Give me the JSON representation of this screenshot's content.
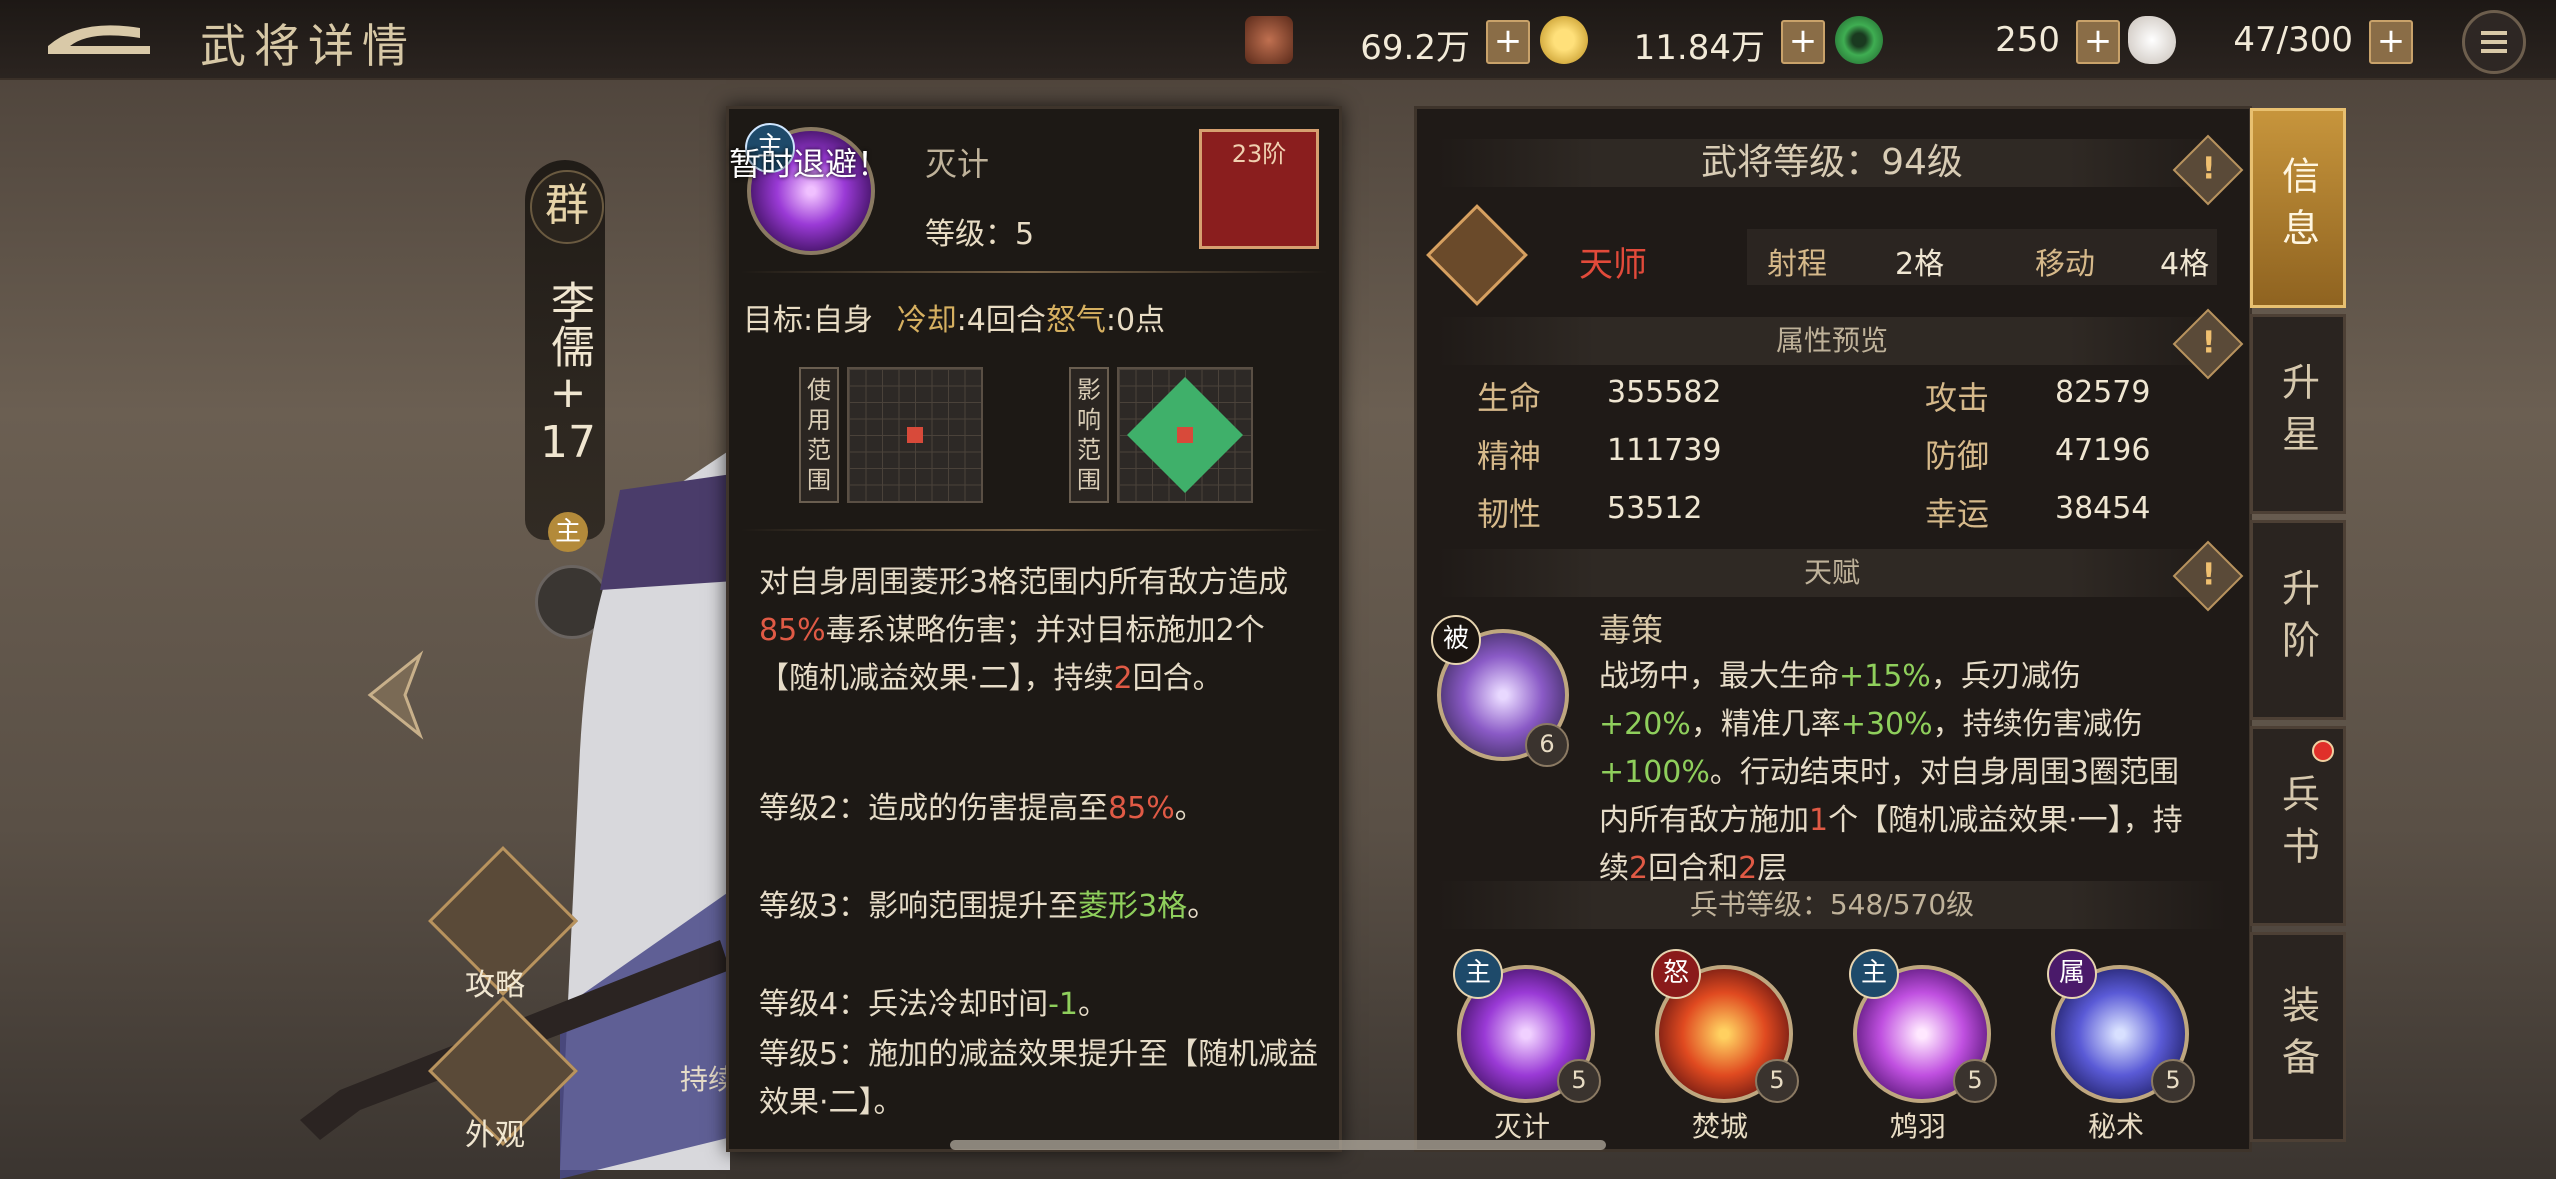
{
  "header": {
    "title": "武将详情"
  },
  "resources": [
    {
      "icon": "copper-coins-icon",
      "value": "69.2万"
    },
    {
      "icon": "gold-coin-icon",
      "value": "11.84万"
    },
    {
      "icon": "jade-icon",
      "value": "250"
    },
    {
      "icon": "stamina-icon",
      "value": "47/300"
    }
  ],
  "hero": {
    "faction": "群",
    "name": "李儒",
    "plus": "+",
    "level_plus": "17",
    "main_badge": "主"
  },
  "left_buttons": {
    "strategy": "攻略",
    "appearance": "外观",
    "partial_text": "持续"
  },
  "skill_popup": {
    "badge": "主",
    "notice": "暂时退避！",
    "name": "灭计",
    "level_text": "等级：5",
    "tier_text": "23阶",
    "target_line": {
      "target_label": "目标",
      "target_value": "自身",
      "cooldown_label": "冷却",
      "cooldown_value": "4回合",
      "rage_label": "怒气",
      "rage_value": "0点"
    },
    "use_range_label": "使用范围",
    "affect_range_label": "影响范围",
    "description": {
      "p1_a": "对自身周围菱形3格范围内所有敌方造成",
      "p1_pct": "85%",
      "p1_b": "毒系谋略伤害；并对目标施加2个【随机减益效果·二】，持续",
      "p1_turns": "2",
      "p1_c": "回合。"
    },
    "levels": [
      {
        "label": "等级2：造成的伤害提高至",
        "hl": "85%",
        "tail": "。"
      },
      {
        "label": "等级3：影响范围提升至",
        "hl": "菱形3格",
        "tail": "。"
      },
      {
        "label": "等级4：兵法冷却时间",
        "hl": "-1",
        "tail": "。"
      },
      {
        "label": "等级5：施加的减益效果提升至【随机减益效果·二】。",
        "hl": "",
        "tail": ""
      }
    ]
  },
  "info": {
    "general_level": "武将等级：94级",
    "class_name": "天师",
    "range_label": "射程",
    "range_value": "2格",
    "move_label": "移动",
    "move_value": "4格",
    "attr_header": "属性预览",
    "stats": [
      {
        "label": "生命",
        "value": "355582"
      },
      {
        "label": "攻击",
        "value": "82579"
      },
      {
        "label": "精神",
        "value": "111739"
      },
      {
        "label": "防御",
        "value": "47196"
      },
      {
        "label": "韧性",
        "value": "53512"
      },
      {
        "label": "幸运",
        "value": "38454"
      }
    ],
    "talent_header": "天赋",
    "talent": {
      "badge": "被",
      "level": "6",
      "name": "毒策",
      "t1": "战场中，最大生命",
      "v1": "+15%",
      "t2": "，兵刃减伤",
      "v2": "+20%",
      "t3": "，精准几率",
      "v3": "+30%",
      "t4": "，持续伤害减伤",
      "v4": "+100%",
      "t5": "。行动结束时，对自身周围3圈范围内所有敌方施加",
      "v5": "1",
      "t6": "个【随机减益效果·一】，持续",
      "v6": "2",
      "t7": "回合和",
      "v7": "2",
      "t8": "层"
    },
    "book_level": "兵书等级：548/570级",
    "skills": [
      {
        "badge": "主",
        "name": "灭计",
        "level": "5"
      },
      {
        "badge": "怒",
        "name": "焚城",
        "level": "5"
      },
      {
        "badge": "主",
        "name": "鸩羽",
        "level": "5"
      },
      {
        "badge": "属",
        "name": "秘术",
        "level": "5"
      }
    ]
  },
  "tabs": [
    "信息",
    "升星",
    "升阶",
    "兵书",
    "装备"
  ],
  "colors": {
    "accent": "#c7953c",
    "highlight_red": "#e05a45",
    "highlight_green": "#8fcf5c",
    "panel": "#1f1a17"
  }
}
